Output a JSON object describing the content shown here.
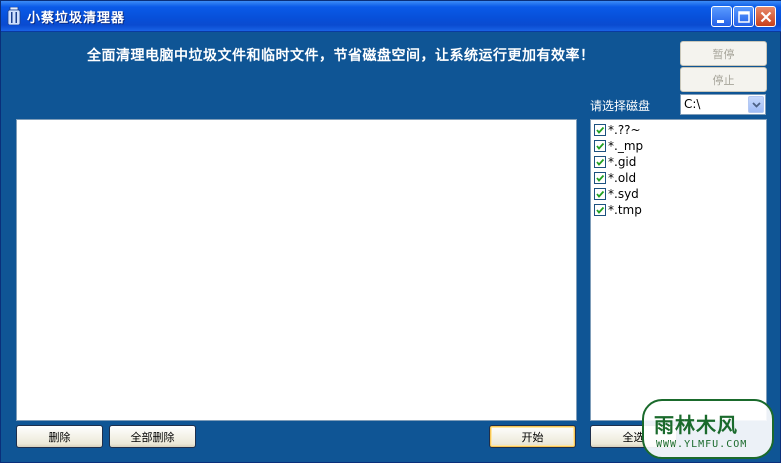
{
  "window": {
    "title": "小蔡垃圾清理器"
  },
  "banner": {
    "text": "全面清理电脑中垃圾文件和临时文件，节省磁盘空间，让系统运行更加有效率！"
  },
  "controls": {
    "pause_label": "暂停",
    "stop_label": "停止",
    "drive_label": "请选择磁盘",
    "drive_value": "C:\\"
  },
  "extensions": [
    {
      "label": "*.??~",
      "checked": true
    },
    {
      "label": "*._mp",
      "checked": true
    },
    {
      "label": "*.gid",
      "checked": true
    },
    {
      "label": "*.old",
      "checked": true
    },
    {
      "label": "*.syd",
      "checked": true
    },
    {
      "label": "*.tmp",
      "checked": true
    }
  ],
  "bottom": {
    "delete_label": "删除",
    "delete_all_label": "全部删除",
    "start_label": "开始",
    "select_all_label": "全选"
  },
  "watermark": {
    "top": "雨林木风",
    "bottom": "WWW.YLMFU.COM"
  },
  "colors": {
    "window_bg": "#0f5595",
    "titlebar": "#0750da",
    "check": "#21a121"
  }
}
